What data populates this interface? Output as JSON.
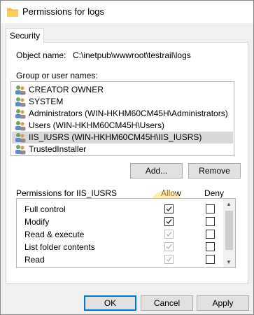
{
  "window": {
    "title": "Permissions for logs"
  },
  "tabs": [
    {
      "label": "Security"
    }
  ],
  "object": {
    "label": "Object name:",
    "value": "C:\\inetpub\\wwwroot\\testrail\\logs"
  },
  "groups": {
    "label": "Group or user names:",
    "items": [
      {
        "label": "CREATOR OWNER"
      },
      {
        "label": "SYSTEM"
      },
      {
        "label": "Administrators (WIN-HKHM60CM45H\\Administrators)"
      },
      {
        "label": "Users (WIN-HKHM60CM45H\\Users)"
      },
      {
        "label": "IIS_IUSRS (WIN-HKHM60CM45H\\IIS_IUSRS)"
      },
      {
        "label": "TrustedInstaller"
      }
    ],
    "selected_index": 4
  },
  "buttons": {
    "add": "Add...",
    "remove": "Remove",
    "ok": "OK",
    "cancel": "Cancel",
    "apply": "Apply"
  },
  "permissions": {
    "header": "Permissions for IIS_IUSRS",
    "allow_label": "Allow",
    "deny_label": "Deny",
    "rows": [
      {
        "label": "Full control",
        "allow": true,
        "allow_enabled": true,
        "deny": false
      },
      {
        "label": "Modify",
        "allow": true,
        "allow_enabled": true,
        "deny": false
      },
      {
        "label": "Read & execute",
        "allow": true,
        "allow_enabled": false,
        "deny": false
      },
      {
        "label": "List folder contents",
        "allow": true,
        "allow_enabled": false,
        "deny": false
      },
      {
        "label": "Read",
        "allow": true,
        "allow_enabled": false,
        "deny": false
      }
    ]
  },
  "colors": {
    "selection": "#d9d9d9",
    "highlight": "#fadc6e",
    "accent": "#0078d7"
  }
}
